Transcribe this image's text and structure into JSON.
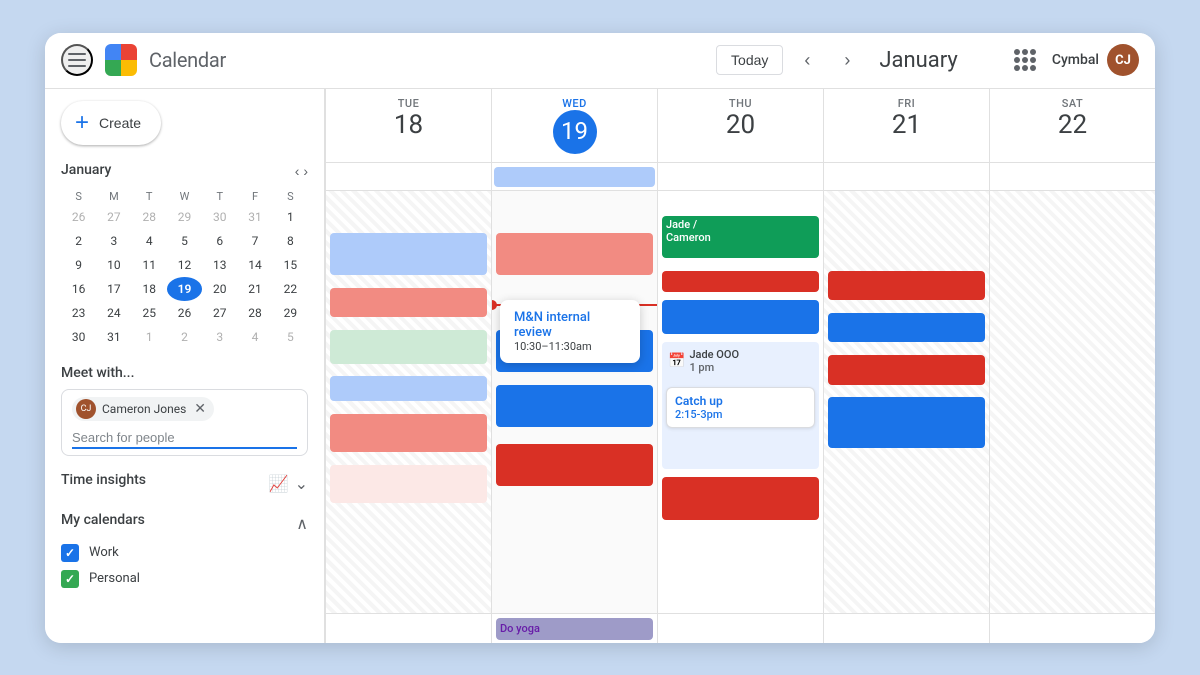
{
  "header": {
    "title": "Calendar",
    "month": "January",
    "today_label": "Today",
    "user_name": "Cymbal",
    "nav_prev": "‹",
    "nav_next": "›"
  },
  "sidebar": {
    "create_label": "Create",
    "mini_cal_title": "January",
    "days_of_week": [
      "S",
      "M",
      "T",
      "W",
      "T",
      "F",
      "S"
    ],
    "meet_with_label": "Meet with...",
    "contact_name": "Cameron Jones",
    "search_placeholder": "Search for people",
    "time_insights_label": "Time insights",
    "my_calendars_label": "My calendars",
    "calendars": [
      {
        "label": "Work",
        "color": "blue",
        "checked": true
      },
      {
        "label": "Personal",
        "color": "green",
        "checked": true
      }
    ]
  },
  "calendar": {
    "days": [
      {
        "name": "TUE",
        "num": "18",
        "is_today": false
      },
      {
        "name": "WED",
        "num": "19",
        "is_today": true
      },
      {
        "name": "THU",
        "num": "20",
        "is_today": false
      },
      {
        "name": "FRI",
        "num": "21",
        "is_today": false
      },
      {
        "name": "SAT",
        "num": "22",
        "is_today": false
      }
    ]
  },
  "events": {
    "all_day": {
      "wed": {
        "label": "",
        "color": "light-blue"
      }
    },
    "popup": {
      "title": "M&N internal review",
      "time": "10:30–11:30am"
    },
    "thu_green": "Jade /\nCameron",
    "thu_jade_ooo": "Jade OOO",
    "thu_jade_time": "1 pm",
    "catchup_title": "Catch up",
    "catchup_time": "2:15-3pm",
    "do_yoga": "Do yoga"
  }
}
